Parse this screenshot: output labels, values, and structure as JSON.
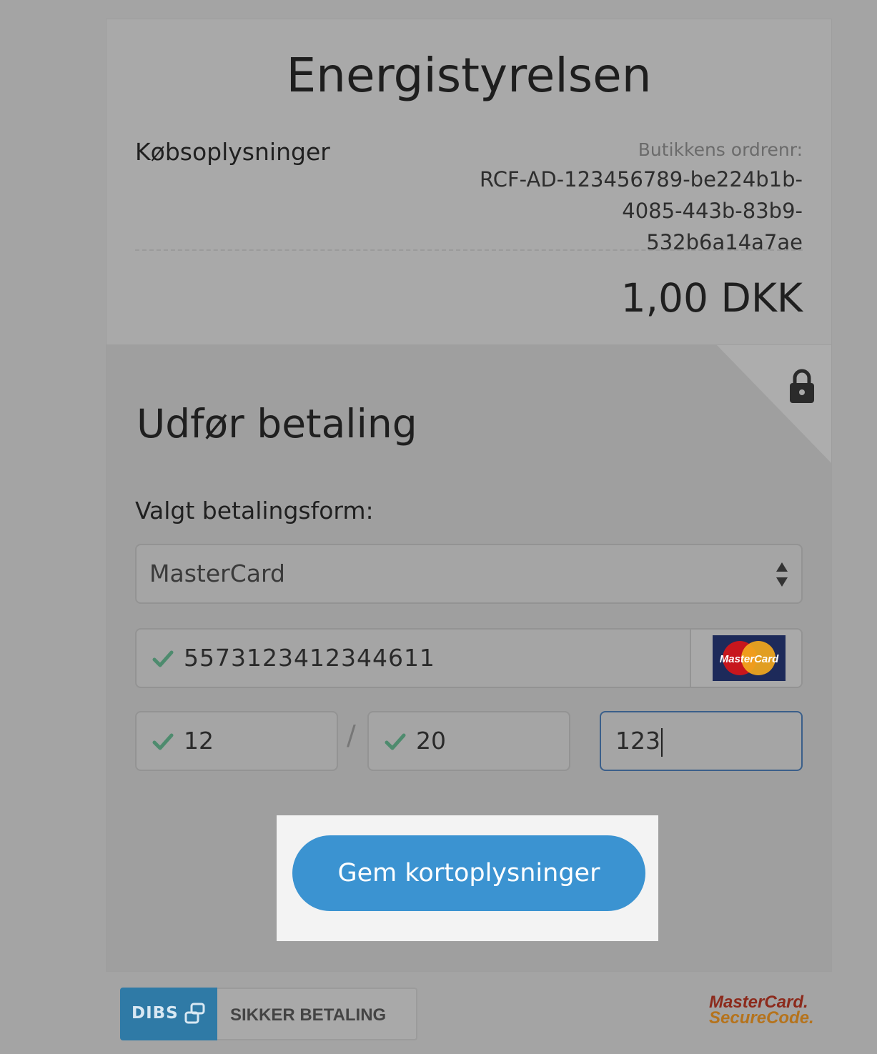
{
  "merchant": {
    "name": "Energistyrelsen"
  },
  "purchase": {
    "label": "Købsoplysninger",
    "order_label": "Butikkens ordrenr:",
    "order_line1": "RCF-AD-123456789-be224b1b-",
    "order_line2": "4085-443b-83b9-532b6a14a7ae",
    "amount": "1,00 DKK"
  },
  "payment": {
    "title": "Udfør betaling",
    "method_label": "Valgt betalingsform:",
    "method_value": "MasterCard",
    "card_number": "5573123412344611",
    "card_logo_text": "MasterCard",
    "exp_month": "12",
    "separator": "/",
    "exp_year": "20",
    "cvc": "123",
    "save_button": "Gem kortoplysninger"
  },
  "footer": {
    "dibs_logo": "DIBS",
    "secure_label": "SIKKER BETALING",
    "securecode_line1": "MasterCard.",
    "securecode_line2": "SecureCode."
  },
  "colors": {
    "button": "#3b93d1",
    "check": "#4e8b6e",
    "dibs": "#2f7aa6"
  },
  "icons": [
    "lock-icon",
    "sort-arrows-icon",
    "check-icon",
    "mastercard-logo",
    "dibs-link-icon"
  ]
}
